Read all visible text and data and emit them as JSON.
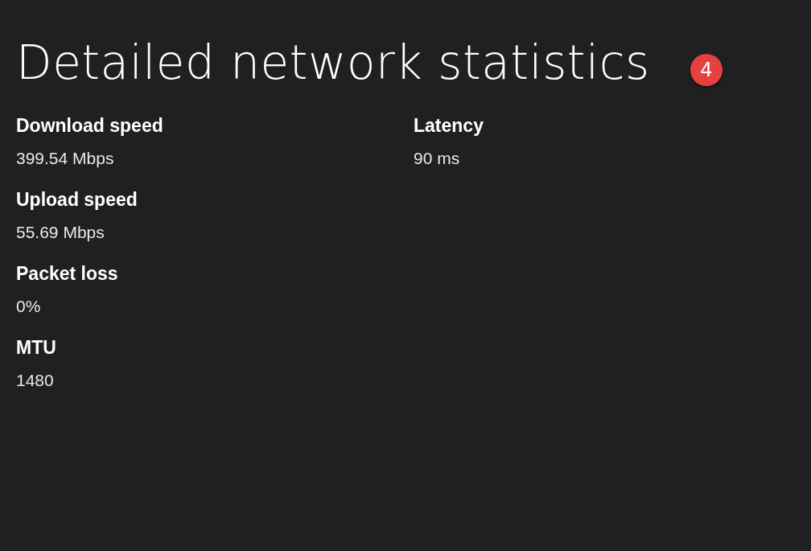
{
  "title": "Detailed network statistics",
  "badge": "4",
  "columns": [
    {
      "stats": [
        {
          "label": "Download speed",
          "value": "399.54 Mbps"
        },
        {
          "label": "Upload speed",
          "value": "55.69 Mbps"
        },
        {
          "label": "Packet loss",
          "value": "0%"
        },
        {
          "label": "MTU",
          "value": "1480"
        }
      ]
    },
    {
      "stats": [
        {
          "label": "Latency",
          "value": "90 ms"
        }
      ]
    }
  ]
}
